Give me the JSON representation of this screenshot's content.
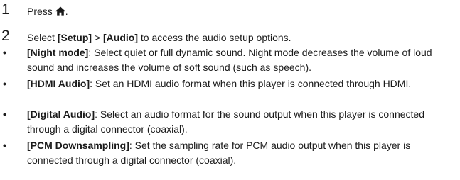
{
  "steps": [
    {
      "number": "1",
      "prefix": "Press",
      "icon": "home-icon",
      "suffix": "."
    },
    {
      "number": "2",
      "select": "Select",
      "menu1": "[Setup]",
      "sep": ">",
      "menu2": "[Audio]",
      "rest": "to access the audio setup options."
    }
  ],
  "bullet_symbol": "•",
  "options": [
    {
      "term": "[Night mode]",
      "desc": ": Select quiet or full dynamic sound. Night mode decreases the volume of loud sound and increases the volume of soft sound (such as speech)."
    },
    {
      "term": "[HDMI Audio]",
      "desc": ": Set an HDMI audio format when this player is connected through HDMI."
    },
    {
      "term": "[Digital Audio]",
      "desc": ": Select an audio format for the sound output when this player is connected through a digital connector (coaxial)."
    },
    {
      "term": "[PCM Downsampling]",
      "desc": ": Set the sampling rate for PCM audio output when this player is connected through a digital connector (coaxial)."
    }
  ]
}
